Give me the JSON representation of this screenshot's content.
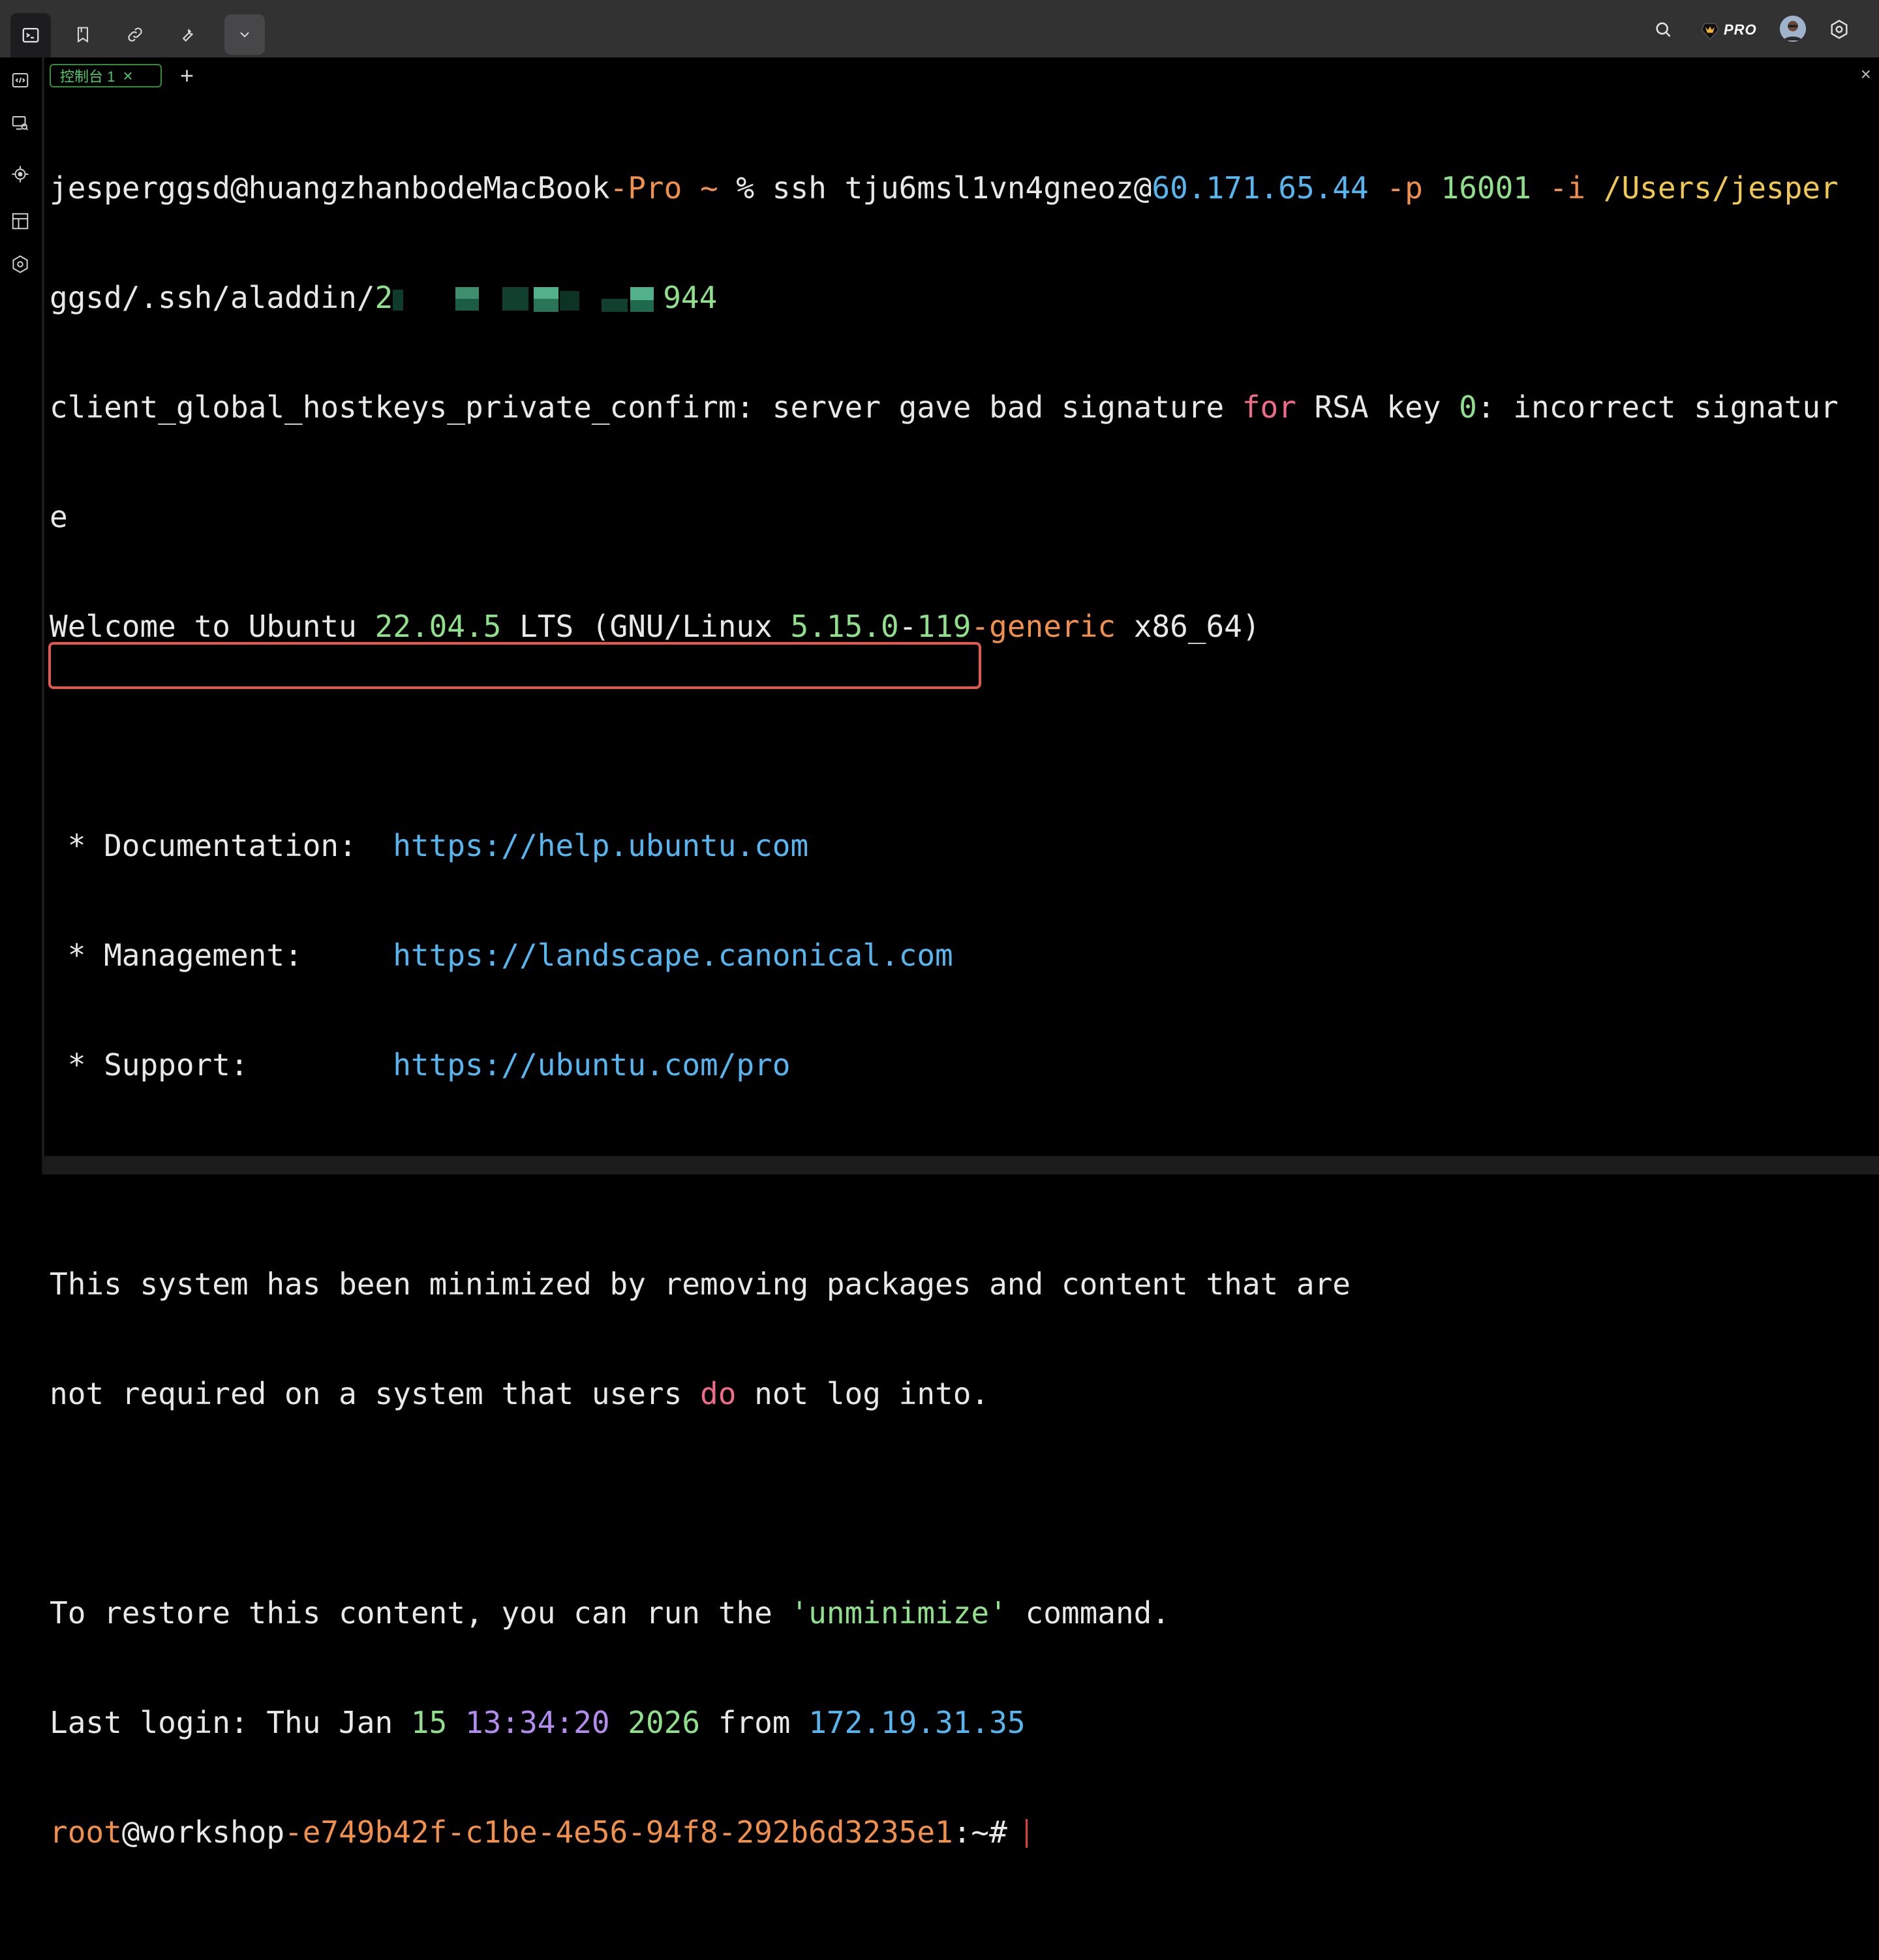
{
  "toolbar": {
    "icons": [
      "terminal-icon",
      "bookmark-icon",
      "link-icon",
      "wrench-icon",
      "chevron-down-icon"
    ],
    "right_icons": [
      "search-icon",
      "pro-badge",
      "avatar",
      "settings-icon"
    ],
    "pro_label": "PRO"
  },
  "left_rail": {
    "icons": [
      "code-window-icon",
      "monitor-search-icon",
      "crosshair-icon",
      "layout-icon",
      "hexagon-settings-icon"
    ]
  },
  "tabs": [
    {
      "label": "控制台 1",
      "active": true,
      "close": "×"
    }
  ],
  "tab_add": "+",
  "pane_close": "×",
  "terminal": {
    "line1": {
      "user_host": "jesperggsd@huangzhanbodeMacBook",
      "host_suffix": "-Pro",
      "tilde": " ~",
      "percent": " % ",
      "cmd": "ssh tju6msl1vn4gneoz@",
      "ip": "60.171.65.44",
      "flag_p": " -p ",
      "port": "16001",
      "flag_i": " -i ",
      "path": "/Users/jesper"
    },
    "line2": {
      "path_a": "ggsd/.ssh/aladdin/",
      "path_start": "2",
      "path_end": "944"
    },
    "line3": {
      "a": "client_global_hostkeys_private_confirm: server gave bad signature ",
      "for": "for",
      "b": " RSA key ",
      "zero": "0",
      "c": ": incorrect signatur"
    },
    "line4": "e",
    "line5": {
      "a": "Welcome to Ubuntu ",
      "ver": "22.04.5",
      "b": " LTS (GNU/Linux ",
      "kv1": "5.15.0",
      "dash": "-",
      "kv2": "119",
      "generic": "-generic",
      "c": " x86_64)"
    },
    "doc_label": " * Documentation:  ",
    "doc_url": "https://help.ubuntu.com",
    "mgmt_label": " * Management:     ",
    "mgmt_url": "https://landscape.canonical.com",
    "support_label": " * Support:        ",
    "support_url": "https://ubuntu.com/pro",
    "min1": "This system has been minimized by removing packages and content that are",
    "min2": {
      "a": "not required on a system that users ",
      "do": "do",
      "b": " not log into."
    },
    "restore": {
      "a": "To restore this content, you can run the ",
      "q": "'unminimize'",
      "b": " command."
    },
    "last_login": {
      "a": "Last login: Thu Jan ",
      "day": "15",
      "time": "13:34:20",
      "year": "2026",
      "from": " from ",
      "ip": "172.19.31.35"
    },
    "prompt": {
      "user": "root",
      "at_host": "@workshop",
      "host_id": "-e749b42f-c1be-4e56-94f8-292b6d3235e1",
      "suffix": ":~# "
    }
  },
  "colors": {
    "highlight_box": "#e25a4f",
    "tab_green": "#4cc96a"
  }
}
